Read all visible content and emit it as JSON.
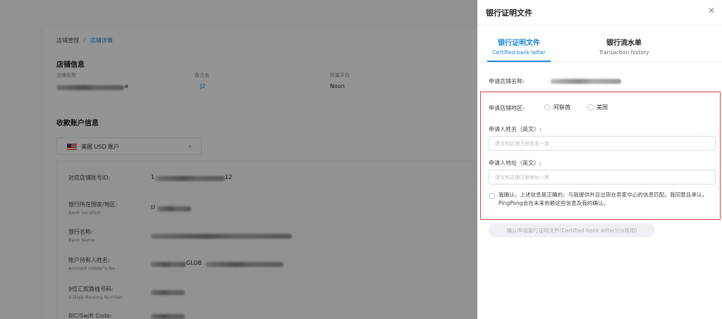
{
  "background": {
    "breadcrumb": {
      "parent": "店铺管理",
      "separator": "/",
      "current": "店铺详情"
    },
    "store_info": {
      "title": "店铺信息",
      "col1_label": "店铺名称",
      "col1_value_suffix": "e",
      "col2_label": "备注名",
      "col2_value": "J2",
      "col3_label": "所属平台",
      "col3_value": "Noon"
    },
    "payout": {
      "title": "收款账户信息",
      "account_select": "美国 USD 账户",
      "rows": [
        {
          "label": "对应店铺账号ID:",
          "sub": "",
          "value_prefix": "1",
          "value_suffix": "12"
        },
        {
          "label": "银行所在国家/地区:",
          "sub": "Bank Location",
          "value_prefix": "U",
          "value_suffix": ""
        },
        {
          "label": "银行名称:",
          "sub": "Bank Name",
          "value_prefix": "",
          "value_suffix": ""
        },
        {
          "label": "账户持有人姓名:",
          "sub": "Account Holder's Na",
          "value_prefix": "",
          "value_suffix": "GLOB"
        },
        {
          "label": "9位汇款路线号码:",
          "sub": "9-Digit Routing Number",
          "value_prefix": "",
          "value_suffix": ""
        },
        {
          "label": "BIC/Swift Code:",
          "sub": "",
          "value_prefix": "",
          "value_suffix": ""
        }
      ]
    }
  },
  "drawer": {
    "title": "银行证明文件",
    "close_icon": "close-icon",
    "tabs": [
      {
        "label": "银行证明文件",
        "sublabel": "Certified bank letter",
        "active": true
      },
      {
        "label": "银行流水单",
        "sublabel": "Transaction history",
        "active": false
      }
    ],
    "store_name_label": "申请店铺名称:",
    "region_label": "申请店铺地区:",
    "region_options": [
      "阿联酋",
      "美国"
    ],
    "name_label": "申请人姓名（英文）:",
    "name_placeholder": "建议和店铺注册姓名一致",
    "address_label": "申请人地址（英文）:",
    "address_placeholder": "建议和店铺注册地址一致",
    "confirm_text": "我确认，上述信息是正确的，与我提供并且出现在卖家中心的信息匹配。我同意且承认，PingPong会在未来依赖这些信息及我的确认。",
    "submit_label": "确认申请银行证明文件(Certified bank letter)(ro禁用)",
    "accent_color": "#1a87d8",
    "highlight_color": "#e0403a"
  }
}
